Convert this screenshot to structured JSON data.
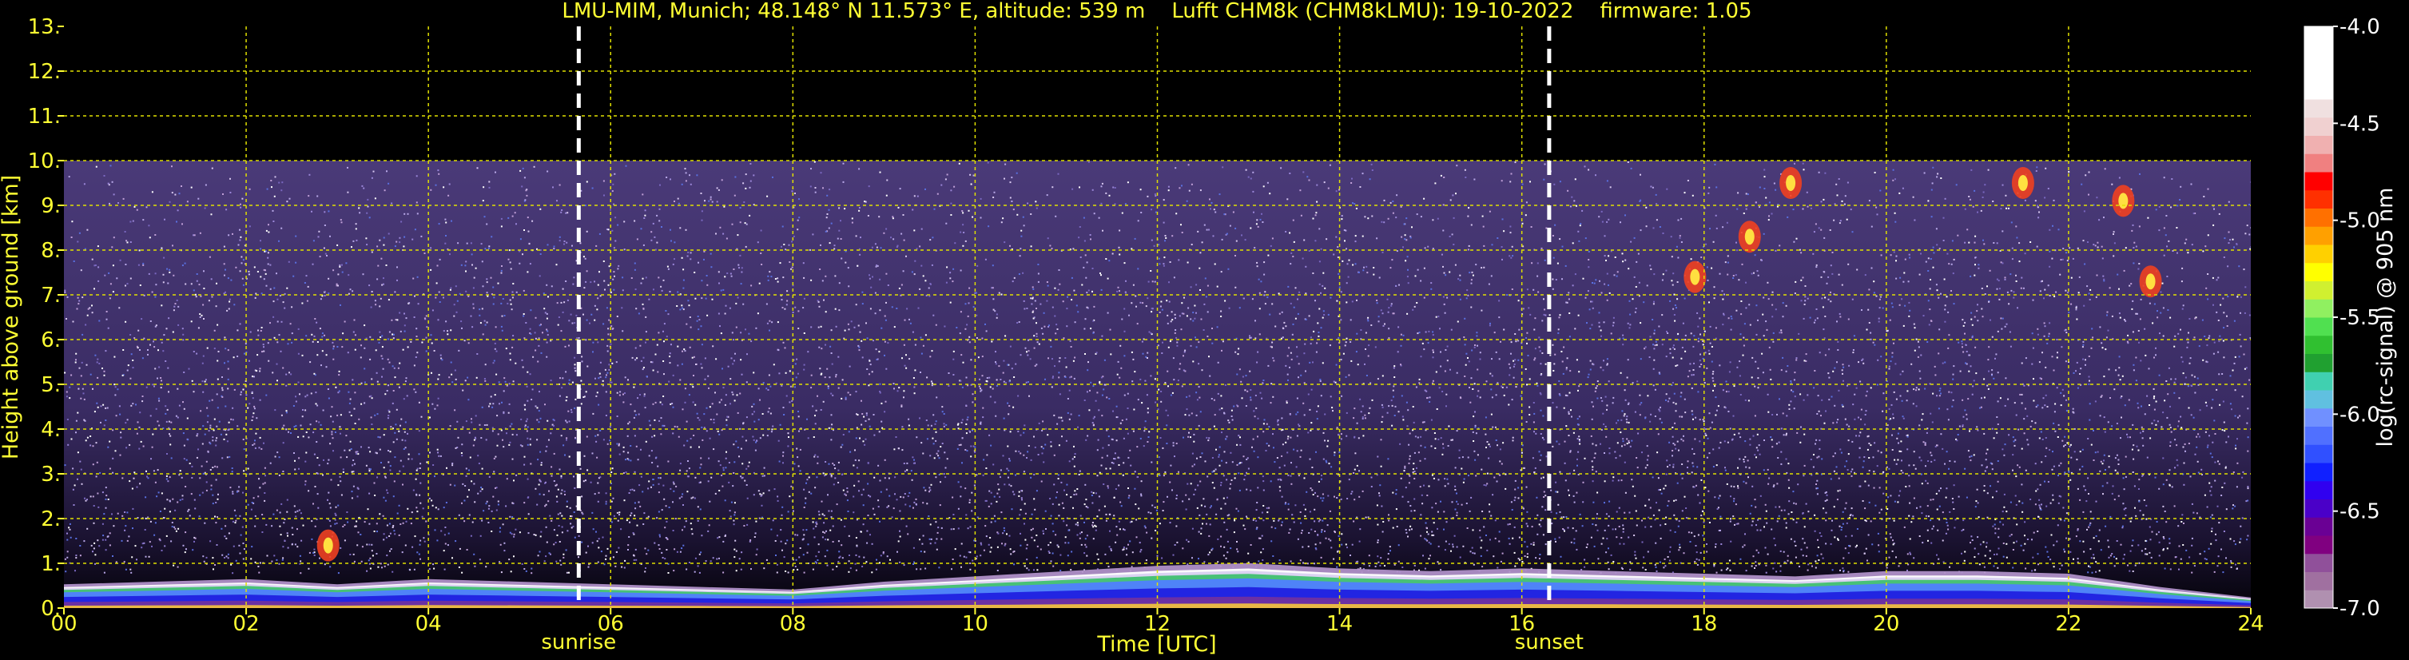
{
  "chart_data": {
    "type": "heatmap",
    "title": "LMU-MIM, Munich; 48.148° N 11.573° E, altitude: 539 m    Lufft CHM8k (CHM8kLMU): 19-10-2022    firmware: 1.05",
    "xlabel": "Time [UTC]",
    "ylabel": "Height above ground [km]",
    "x_ticks": [
      "00",
      "02",
      "04",
      "06",
      "08",
      "10",
      "12",
      "14",
      "16",
      "18",
      "20",
      "22",
      "24"
    ],
    "y_ticks": [
      "0.",
      "1.",
      "2.",
      "3.",
      "4.",
      "5.",
      "6.",
      "7.",
      "8.",
      "9.",
      "10.",
      "11.",
      "12.",
      "13."
    ],
    "xlim": [
      0,
      24
    ],
    "ylim": [
      0,
      13
    ],
    "grid": true,
    "markers": [
      {
        "label": "sunrise",
        "time": 5.65
      },
      {
        "label": "sunset",
        "time": 16.3
      }
    ],
    "colorbar": {
      "label": "log(rc-signal) @ 905 nm",
      "ticks": [
        "-4.0",
        "-4.5",
        "-5.0",
        "-5.5",
        "-6.0",
        "-6.5",
        "-7.0"
      ],
      "range": [
        -7.0,
        -4.0
      ],
      "colors": [
        "#b090b0",
        "#a070a0",
        "#90509a",
        "#800080",
        "#6a0094",
        "#4a00c8",
        "#3000f0",
        "#1020ff",
        "#3050ff",
        "#5070ff",
        "#7090ff",
        "#60c0e0",
        "#40d0b0",
        "#20a030",
        "#30c030",
        "#50e050",
        "#90f060",
        "#d0f030",
        "#ffff00",
        "#ffd000",
        "#ffa000",
        "#ff7000",
        "#ff3000",
        "#ff0000",
        "#f08080",
        "#f0b0b0",
        "#f0d0d0",
        "#f0e0e0",
        "#ffffff",
        "#ffffff",
        "#ffffff",
        "#ffffff"
      ]
    },
    "noise_top_km": 10.0,
    "boundary_layer": [
      {
        "time": 0,
        "height": 0.45
      },
      {
        "time": 1,
        "height": 0.5
      },
      {
        "time": 2,
        "height": 0.55
      },
      {
        "time": 3,
        "height": 0.45
      },
      {
        "time": 4,
        "height": 0.55
      },
      {
        "time": 5,
        "height": 0.5
      },
      {
        "time": 6,
        "height": 0.45
      },
      {
        "time": 7,
        "height": 0.4
      },
      {
        "time": 8,
        "height": 0.35
      },
      {
        "time": 9,
        "height": 0.5
      },
      {
        "time": 10,
        "height": 0.6
      },
      {
        "time": 11,
        "height": 0.7
      },
      {
        "time": 12,
        "height": 0.8
      },
      {
        "time": 13,
        "height": 0.85
      },
      {
        "time": 14,
        "height": 0.75
      },
      {
        "time": 15,
        "height": 0.7
      },
      {
        "time": 16,
        "height": 0.75
      },
      {
        "time": 17,
        "height": 0.7
      },
      {
        "time": 18,
        "height": 0.65
      },
      {
        "time": 19,
        "height": 0.6
      },
      {
        "time": 20,
        "height": 0.7
      },
      {
        "time": 21,
        "height": 0.7
      },
      {
        "time": 22,
        "height": 0.65
      },
      {
        "time": 23,
        "height": 0.4
      },
      {
        "time": 24,
        "height": 0.2
      }
    ],
    "cloud_patches": [
      {
        "time": 18.95,
        "height": 9.5
      },
      {
        "time": 21.5,
        "height": 9.5
      },
      {
        "time": 22.6,
        "height": 9.1
      },
      {
        "time": 22.9,
        "height": 7.3
      },
      {
        "time": 18.5,
        "height": 8.3
      },
      {
        "time": 17.9,
        "height": 7.4
      },
      {
        "time": 2.9,
        "height": 1.4
      }
    ]
  }
}
